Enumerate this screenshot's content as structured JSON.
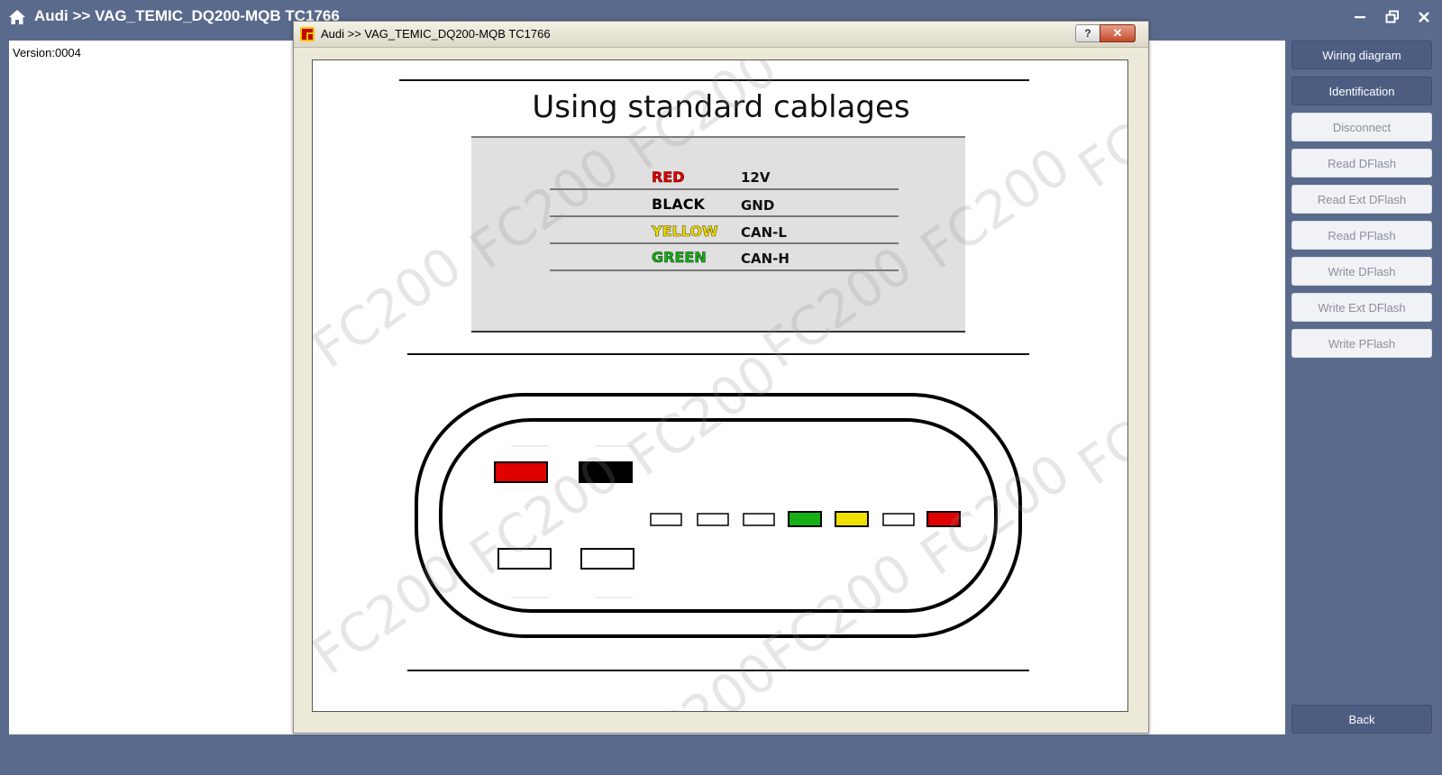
{
  "app": {
    "title": "Audi >> VAG_TEMIC_DQ200-MQB TC1766",
    "home_icon": "home-icon",
    "window_controls": [
      "minimize-icon",
      "restore-icon",
      "close-icon"
    ]
  },
  "main": {
    "version": "Version:0004"
  },
  "sidebar": {
    "buttons": [
      {
        "label": "Wiring diagram",
        "state": "active"
      },
      {
        "label": "Identification",
        "state": "active"
      },
      {
        "label": "Disconnect",
        "state": "disabled"
      },
      {
        "label": "Read DFlash",
        "state": "disabled"
      },
      {
        "label": "Read Ext DFlash",
        "state": "disabled"
      },
      {
        "label": "Read PFlash",
        "state": "disabled"
      },
      {
        "label": "Write DFlash",
        "state": "disabled"
      },
      {
        "label": "Write Ext DFlash",
        "state": "disabled"
      },
      {
        "label": "Write PFlash",
        "state": "disabled"
      }
    ],
    "back_label": "Back"
  },
  "dialog": {
    "title": "Audi >> VAG_TEMIC_DQ200-MQB TC1766",
    "help_label": "?",
    "close_label": "✕",
    "heading": "Using  standard cablages",
    "wires": [
      {
        "color_name": "RED",
        "signal": "12V",
        "color": "#e00000"
      },
      {
        "color_name": "BLACK",
        "signal": "GND",
        "color": "#000000"
      },
      {
        "color_name": "YELLOW",
        "signal": "CAN-L",
        "color": "#f0e000"
      },
      {
        "color_name": "GREEN",
        "signal": "CAN-H",
        "color": "#16b016"
      }
    ],
    "watermark": "FC200",
    "connector": {
      "large_pins_top": [
        "red",
        "black"
      ],
      "small_pins": [
        "empty",
        "empty",
        "empty",
        "green",
        "yellow",
        "empty",
        "red"
      ],
      "large_pins_bottom": [
        "empty",
        "empty"
      ]
    }
  },
  "colors": {
    "chrome": "#5a6a8c",
    "button_active": "#4d5d82",
    "button_disabled": "#f0f2f6",
    "pin_red": "#e00000",
    "pin_black": "#000000",
    "pin_green": "#16b016",
    "pin_yellow": "#f0e000"
  }
}
